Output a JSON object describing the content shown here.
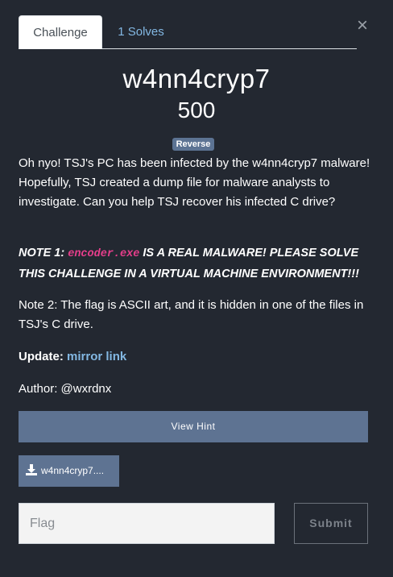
{
  "tabs": [
    {
      "label": "Challenge",
      "active": true
    },
    {
      "label": "1 Solves",
      "active": false
    }
  ],
  "close_glyph": "×",
  "challenge": {
    "name": "w4nn4cryp7",
    "points": "500",
    "category": "Reverse"
  },
  "description": {
    "p1": "Oh nyo! TSJ's PC has been infected by the w4nn4cryp7 malware! Hopefully, TSJ created a dump file for malware analysts to investigate. Can you help TSJ recover his infected C drive?",
    "note1_prefix": "NOTE 1: ",
    "note1_code": "encoder.exe",
    "note1_suffix": " IS A REAL MALWARE! PLEASE SOLVE THIS CHALLENGE IN A VIRTUAL MACHINE ENVIRONMENT!!!",
    "p3": "Note 2: The flag is ASCII art, and it is hidden in one of the files in TSJ's C drive.",
    "update_label": "Update:",
    "update_link": "mirror link",
    "author": "Author: @wxrdnx"
  },
  "hint_button": "View Hint",
  "file_button": "w4nn4cryp7....",
  "flag_input": {
    "placeholder": "Flag",
    "value": ""
  },
  "submit_button": "Submit",
  "colors": {
    "background": "#232831",
    "accent": "#5e7392",
    "link": "#83b8e3",
    "code": "#e83e8c"
  },
  "icons": [
    "close-icon",
    "download-icon"
  ]
}
